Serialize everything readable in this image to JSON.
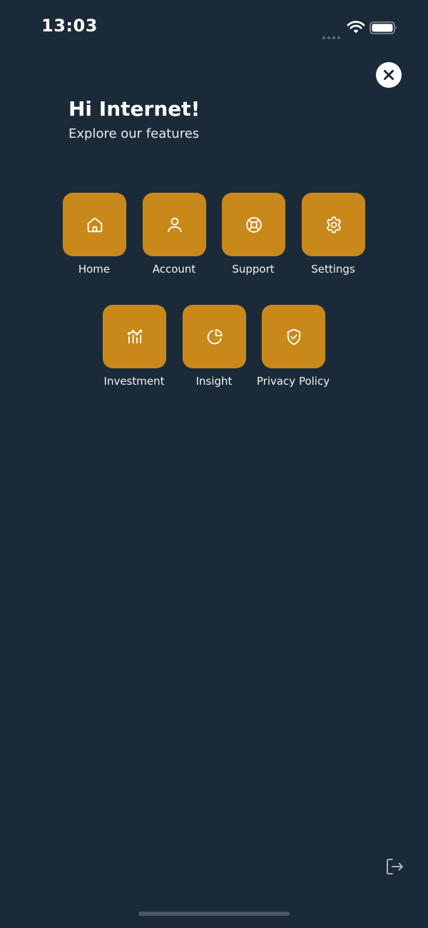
{
  "status_bar": {
    "time": "13:03"
  },
  "header": {
    "greeting": "Hi Internet!",
    "subtitle": "Explore our features"
  },
  "features": {
    "row1": [
      {
        "label": "Home",
        "icon": "home-icon"
      },
      {
        "label": "Account",
        "icon": "user-icon"
      },
      {
        "label": "Support",
        "icon": "lifebuoy-icon"
      },
      {
        "label": "Settings",
        "icon": "gear-icon"
      }
    ],
    "row2": [
      {
        "label": "Investment",
        "icon": "investment-chart-icon"
      },
      {
        "label": "Insight",
        "icon": "pie-chart-icon"
      },
      {
        "label": "Privacy Policy",
        "icon": "shield-check-icon"
      }
    ]
  },
  "colors": {
    "background": "#1b2a38",
    "tile_accent": "#c8891a",
    "text": "#ffffff"
  }
}
